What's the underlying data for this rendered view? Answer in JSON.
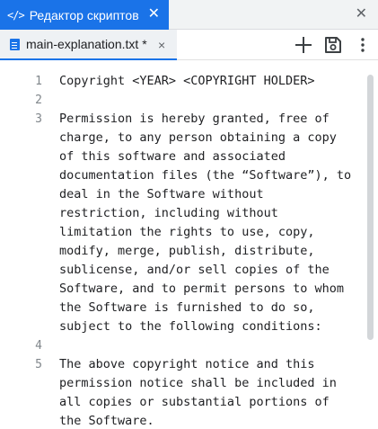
{
  "window": {
    "tab_icon": "</>",
    "tab_title": "Редактор скриптов",
    "tab_close": "✕",
    "close": "✕"
  },
  "file_tab": {
    "name": "main-explanation.txt",
    "modified_marker": "*",
    "close": "×"
  },
  "toolbar": {
    "add": "add-icon",
    "save": "save-icon",
    "more": "more-vert-icon"
  },
  "editor": {
    "lines": [
      {
        "num": "1",
        "text": "Copyright <YEAR> <COPYRIGHT HOLDER>"
      },
      {
        "num": "2",
        "text": ""
      },
      {
        "num": "3",
        "text": "Permission is hereby granted, free of\ncharge, to any person obtaining a copy\nof this software and associated\ndocumentation files (the “Software”), to\ndeal in the Software without\nrestriction, including without\nlimitation the rights to use, copy,\nmodify, merge, publish, distribute,\nsublicense, and/or sell copies of the\nSoftware, and to permit persons to whom\nthe Software is furnished to do so,\nsubject to the following conditions:"
      },
      {
        "num": "4",
        "text": ""
      },
      {
        "num": "5",
        "text": "The above copyright notice and this\npermission notice shall be included in\nall copies or substantial portions of\nthe Software."
      }
    ]
  }
}
